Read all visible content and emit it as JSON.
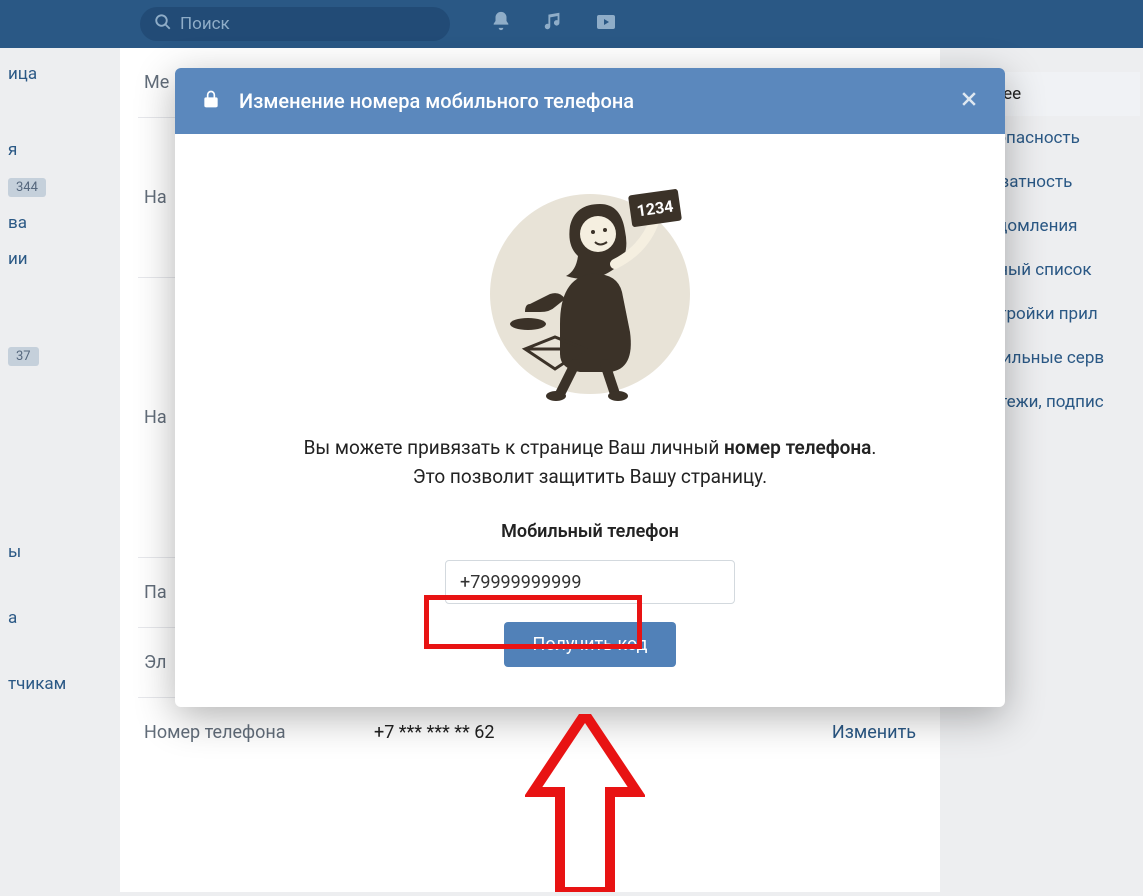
{
  "topbar": {
    "search_placeholder": "Поиск"
  },
  "leftnav": {
    "items": [
      "ица",
      "я",
      "",
      "ва",
      "ии",
      "",
      "",
      "",
      "ы",
      "а",
      "тчикам"
    ],
    "badge1": "344",
    "badge2": "37"
  },
  "rightnav": {
    "items": [
      "Общее",
      "Безопасность",
      "Приватность",
      "Уведомления",
      "Чёрный список",
      "Настройки прил",
      "Мобильные серв",
      "Платежи, подпис"
    ]
  },
  "main": {
    "rows": {
      "menu_label": "Ме",
      "settings_label": "На",
      "settings2_label": "На",
      "password_label": "Па",
      "email_label": "Эл",
      "phone_label": "Номер телефона",
      "phone_value": "+7 *** *** ** 62",
      "change_action": "Изменить"
    }
  },
  "modal": {
    "title": "Изменение номера мобильного телефона",
    "desc_pre": "Вы можете привязать к странице Ваш личный ",
    "desc_bold": "номер телефона",
    "desc_post": ".\nЭто позволит защитить Вашу страницу.",
    "field_label": "Мобильный телефон",
    "phone_value": "+79999999999",
    "submit_label": "Получить код"
  }
}
